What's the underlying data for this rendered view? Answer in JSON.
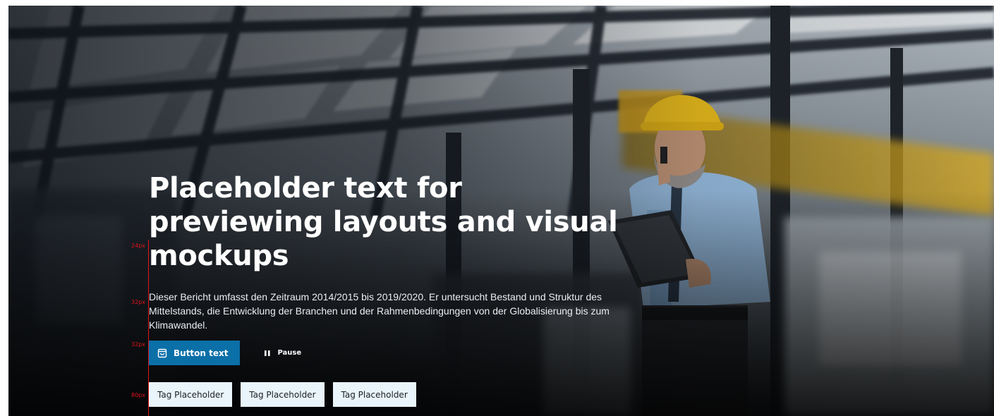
{
  "hero": {
    "headline": "Placeholder text for previewing layouts and visual mockups",
    "description": "Dieser Bericht umfasst den Zeitraum 2014/2015 bis 2019/2020. Er untersucht Bestand und Struktur des Mittelstands, die Entwicklung der Branchen und der Rahmenbedingungen von der Globalisierung bis zum Klimawandel.",
    "primary_button": {
      "label": "Button text",
      "icon": "shopping-bag-icon"
    },
    "pause_button": {
      "label": "Pause",
      "icon": "pause-icon"
    },
    "tags": [
      "Tag Placeholder",
      "Tag Placeholder",
      "Tag Placeholder"
    ],
    "background_image": "industrial factory hall with engineer in yellow hard hat on phone holding clipboard"
  },
  "spacing_guides": [
    "24px",
    "32px",
    "32px",
    "80px"
  ],
  "colors": {
    "primary_button": "#0b6fa8",
    "tag_background": "#e9f4fb",
    "guide": "#e0141e",
    "hard_hat": "#f2c21b"
  }
}
